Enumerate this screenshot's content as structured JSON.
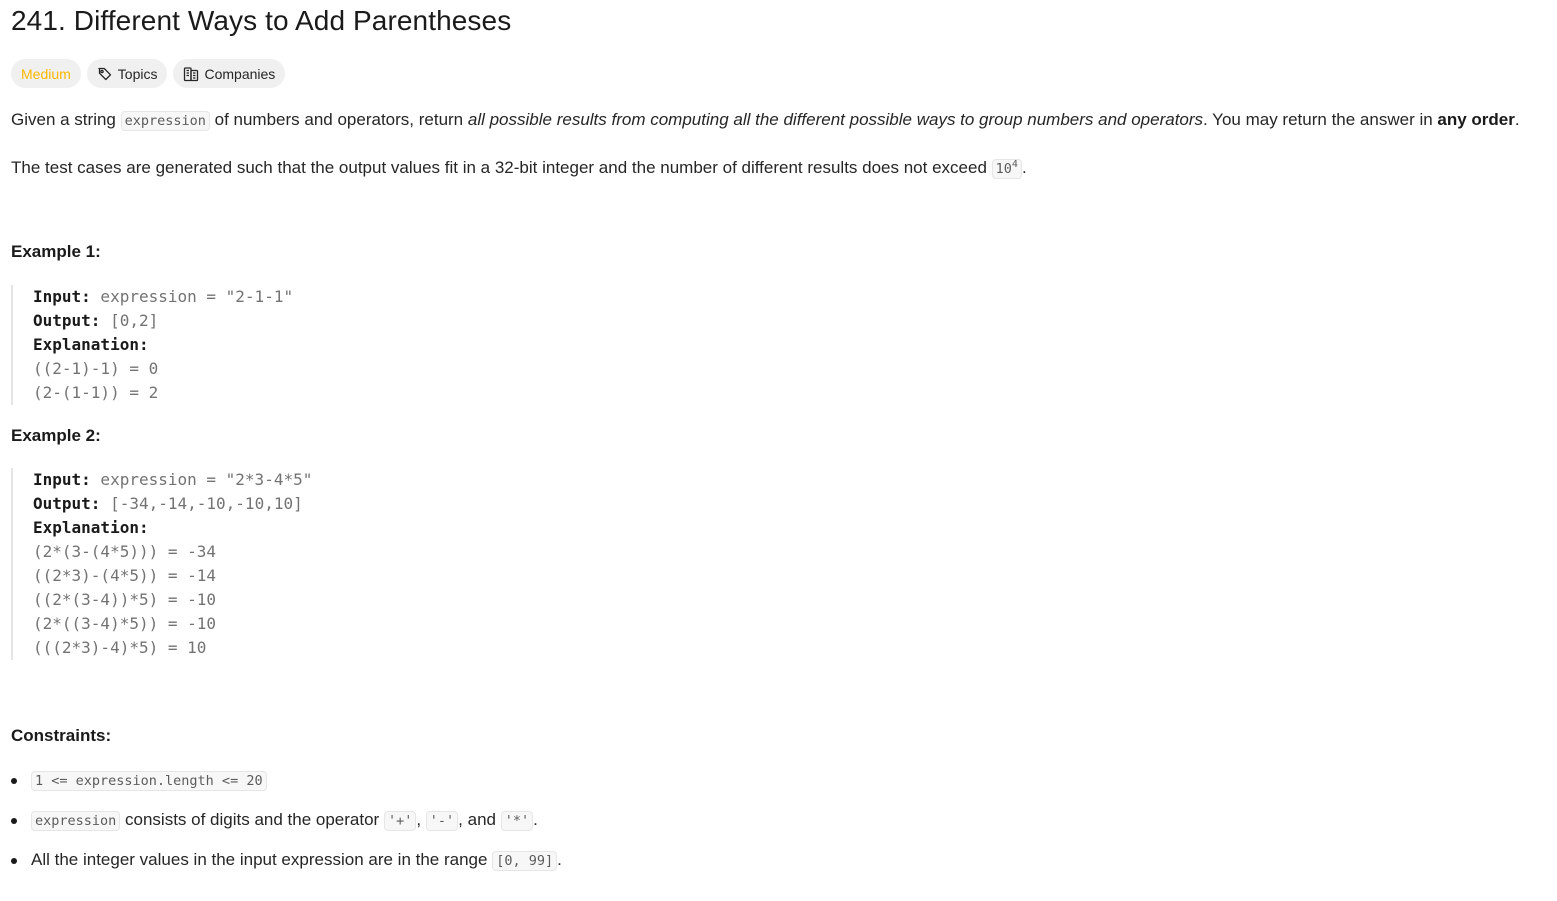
{
  "problem": {
    "title": "241. Different Ways to Add Parentheses",
    "difficulty": "Medium",
    "topics_label": "Topics",
    "companies_label": "Companies",
    "icons": {
      "topics": "tag-icon",
      "companies": "building-icon"
    }
  },
  "description": {
    "p1": {
      "t1": "Given a string ",
      "code1": "expression",
      "t2": " of numbers and operators, return ",
      "em1": "all possible results from computing all the different possible ways to group numbers and operators",
      "t3": ". You may return the answer in ",
      "strong1": "any order",
      "t4": "."
    },
    "p2": {
      "t1": "The test cases are generated such that the output values fit in a 32-bit integer and the number of different results does not exceed ",
      "code_base": "10",
      "code_sup": "4",
      "t2": "."
    }
  },
  "example1": {
    "heading": "Example 1:",
    "input_label": "Input:",
    "input_value": " expression = \"2-1-1\"",
    "output_label": "Output:",
    "output_value": " [0,2]",
    "explanation_label": "Explanation:",
    "lines": [
      "((2-1)-1) = 0",
      "(2-(1-1)) = 2"
    ]
  },
  "example2": {
    "heading": "Example 2:",
    "input_label": "Input:",
    "input_value": " expression = \"2*3-4*5\"",
    "output_label": "Output:",
    "output_value": " [-34,-14,-10,-10,10]",
    "explanation_label": "Explanation:",
    "lines": [
      "(2*(3-(4*5))) = -34",
      "((2*3)-(4*5)) = -14",
      "((2*(3-4))*5) = -10",
      "(2*((3-4)*5)) = -10",
      "(((2*3)-4)*5) = 10"
    ]
  },
  "constraints": {
    "heading": "Constraints:",
    "c1": {
      "code": "1 <= expression.length <= 20"
    },
    "c2": {
      "code1": "expression",
      "t1": " consists of digits and the operator ",
      "code2": "'+'",
      "t2": ", ",
      "code3": "'-'",
      "t3": ", and ",
      "code4": "'*'",
      "t4": "."
    },
    "c3": {
      "t1": "All the integer values in the input expression are in the range ",
      "code1": "[0, 99]",
      "t2": "."
    }
  }
}
